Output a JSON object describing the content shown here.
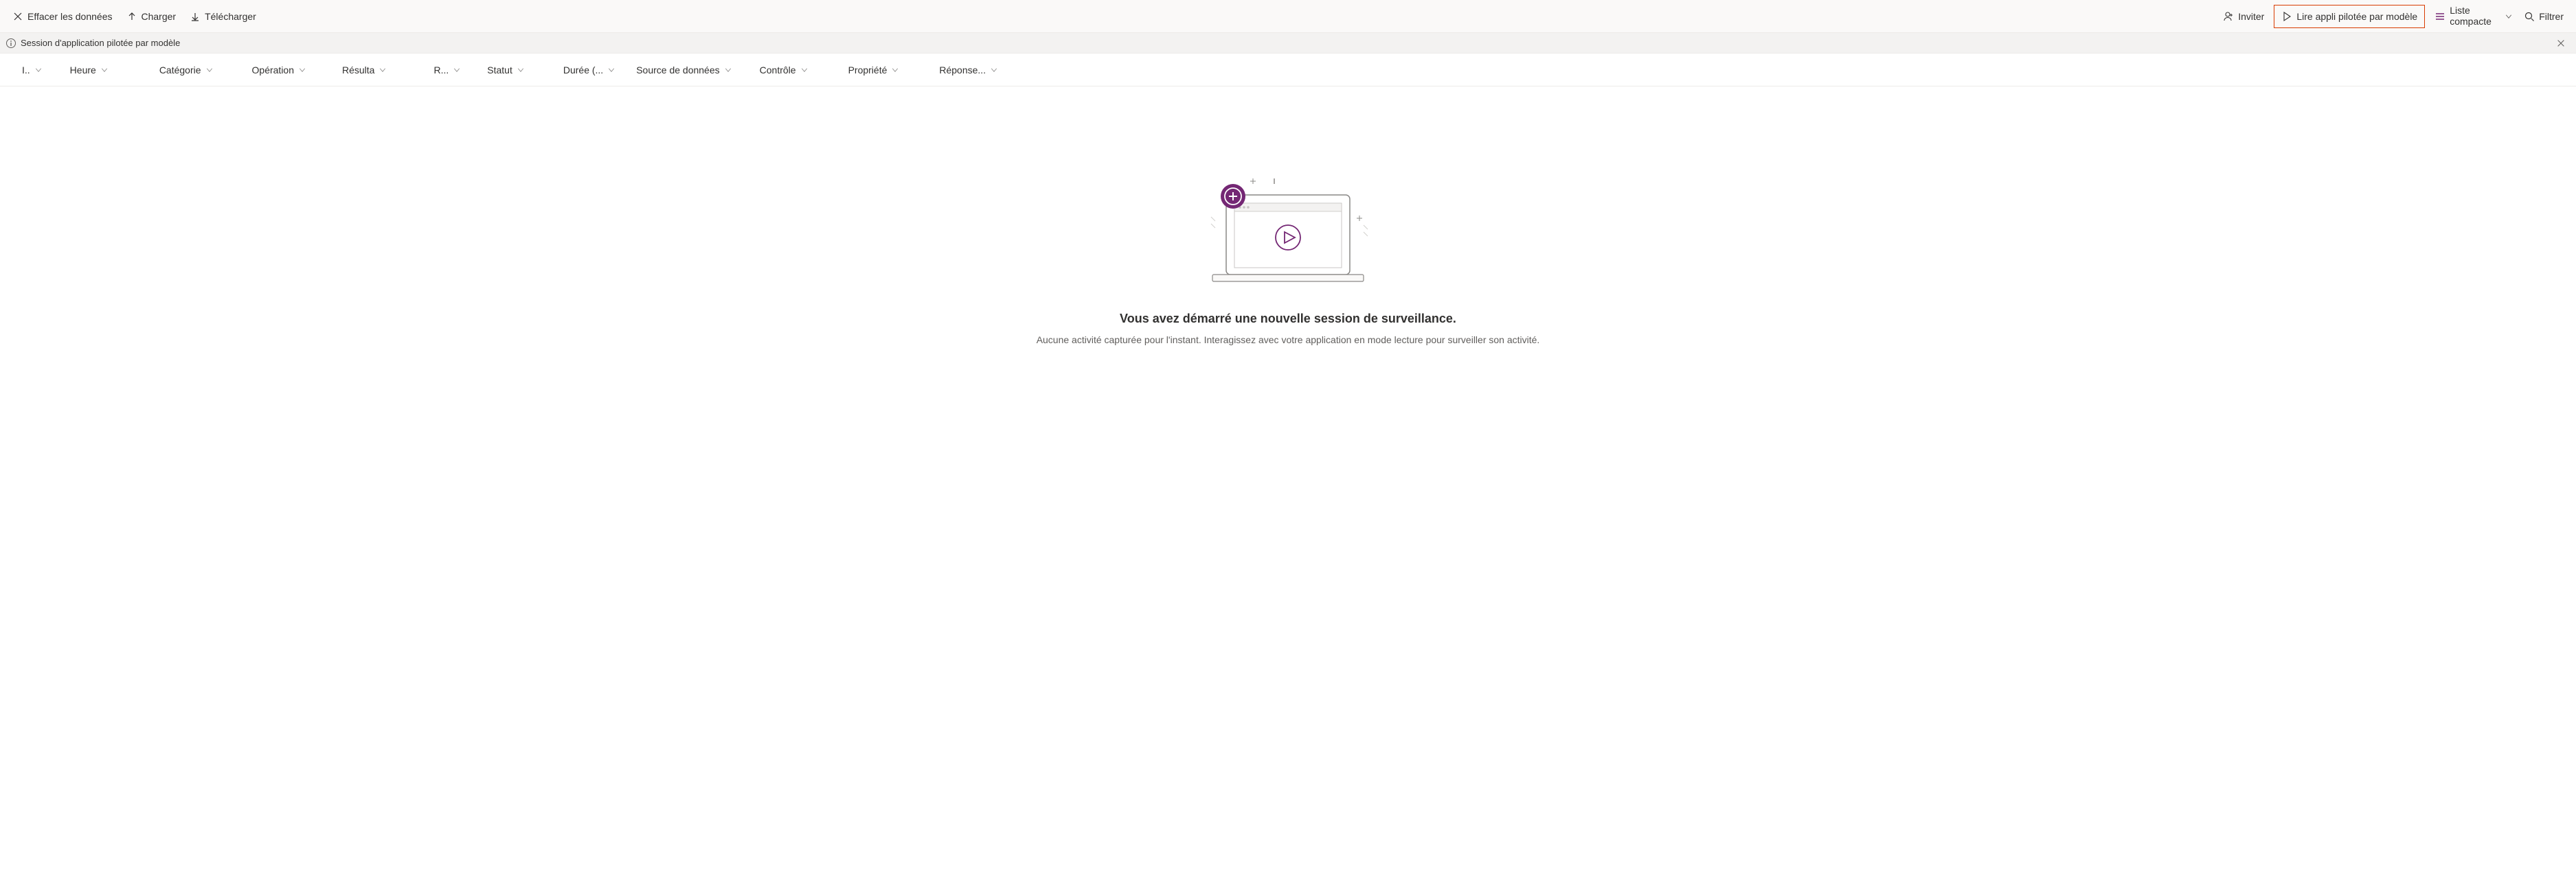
{
  "toolbar": {
    "clear": "Effacer les données",
    "load": "Charger",
    "download": "Télécharger",
    "invite": "Inviter",
    "play_app": "Lire appli pilotée par modèle",
    "list_mode": "Liste compacte",
    "filter": "Filtrer"
  },
  "infobar": {
    "text": "Session d'application pilotée par modèle"
  },
  "columns": {
    "id": "I..",
    "time": "Heure",
    "category": "Catégorie",
    "operation": "Opération",
    "result": "Résulta",
    "r": "R...",
    "status": "Statut",
    "duration": "Durée (...",
    "datasource": "Source de données",
    "control": "Contrôle",
    "property": "Propriété",
    "response": "Réponse..."
  },
  "empty": {
    "title": "Vous avez démarré une nouvelle session de surveillance.",
    "body": "Aucune activité capturée pour l'instant. Interagissez avec votre application en mode lecture pour surveiller son activité."
  },
  "colors": {
    "accent": "#742774",
    "highlight_border": "#d83b01"
  }
}
